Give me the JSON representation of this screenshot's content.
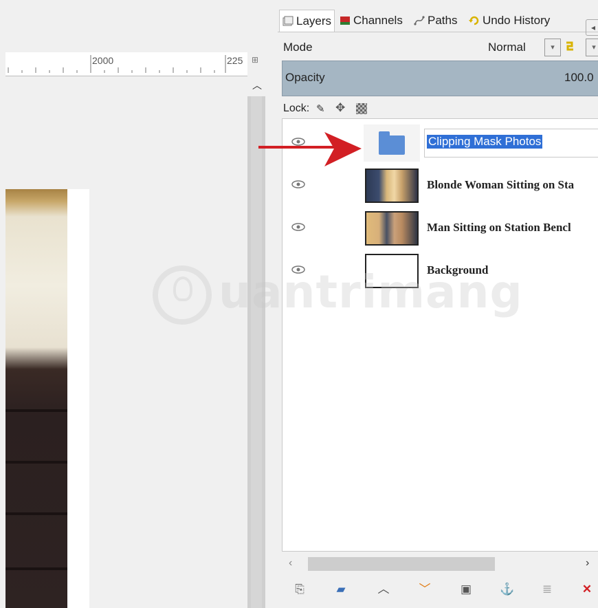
{
  "ruler": {
    "label_a": "2000",
    "label_b": "225"
  },
  "watermark": {
    "text": "uantrimang"
  },
  "tabs": [
    {
      "label": "Layers",
      "icon": "layers-icon"
    },
    {
      "label": "Channels",
      "icon": "channels-icon"
    },
    {
      "label": "Paths",
      "icon": "paths-icon"
    },
    {
      "label": "Undo History",
      "icon": "undo-history-icon"
    }
  ],
  "mode": {
    "label": "Mode",
    "value": "Normal"
  },
  "opacity": {
    "label": "Opacity",
    "value": "100.0"
  },
  "lock": {
    "label": "Lock:"
  },
  "layers": [
    {
      "name": "Clipping Mask Photos",
      "type": "group",
      "editing": true
    },
    {
      "name": "Blonde Woman Sitting on Sta",
      "type": "image"
    },
    {
      "name": "Man Sitting on Station Bencl",
      "type": "image"
    },
    {
      "name": "Background",
      "type": "blank"
    }
  ],
  "colors": {
    "selection": "#2f6fd6",
    "opacity_bar": "#a5b6c3",
    "arrow": "#d21f24"
  }
}
